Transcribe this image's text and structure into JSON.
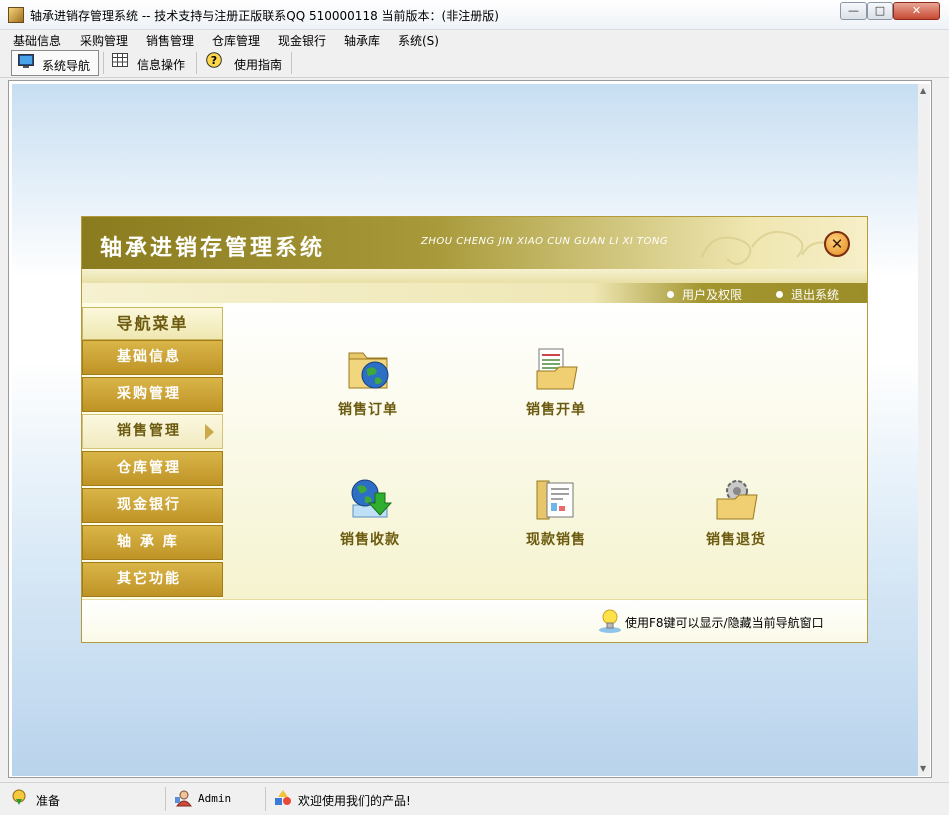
{
  "window": {
    "title": "轴承进销存管理系统 -- 技术支持与注册正版联系QQ 510000118   当前版本：(非注册版)",
    "min_label": "—",
    "max_label": "□",
    "close_label": "✕"
  },
  "menu": [
    {
      "label": "基础信息"
    },
    {
      "label": "采购管理"
    },
    {
      "label": "销售管理"
    },
    {
      "label": "仓库管理"
    },
    {
      "label": "现金银行"
    },
    {
      "label": "轴承库"
    },
    {
      "label": "系统(S)"
    }
  ],
  "toolbar": [
    {
      "label": "系统导航",
      "icon": "monitor-icon",
      "active": true
    },
    {
      "label": "信息操作",
      "icon": "grid-icon",
      "active": false
    },
    {
      "label": "使用指南",
      "icon": "help-icon",
      "active": false
    }
  ],
  "panel": {
    "title": "轴承进销存管理系统",
    "subtitle": "ZHOU CHENG JIN XIAO CUN GUAN LI XI TONG",
    "close_icon": "close-circle-icon",
    "close_glyph": "✕",
    "links": [
      {
        "label": "用户及权限"
      },
      {
        "label": "退出系统"
      }
    ],
    "nav_header": "导航菜单",
    "nav_items": [
      {
        "label": "基础信息",
        "selected": false
      },
      {
        "label": "采购管理",
        "selected": false
      },
      {
        "label": "销售管理",
        "selected": true
      },
      {
        "label": "仓库管理",
        "selected": false
      },
      {
        "label": "现金银行",
        "selected": false
      },
      {
        "label": "轴 承 库",
        "selected": false
      },
      {
        "label": "其它功能",
        "selected": false
      }
    ],
    "functions": [
      {
        "label": "销售订单",
        "icon": "folder-globe-icon"
      },
      {
        "label": "销售开单",
        "icon": "folder-document-icon"
      },
      {
        "label": "销售收款",
        "icon": "globe-download-icon"
      },
      {
        "label": "现款销售",
        "icon": "folder-form-icon"
      },
      {
        "label": "销售退货",
        "icon": "folder-gear-icon"
      }
    ],
    "tip": "使用F8键可以显示/隐藏当前导航窗口",
    "tip_icon": "lightbulb-icon"
  },
  "statusbar": [
    {
      "label": "准备",
      "icon": "ready-icon"
    },
    {
      "label": "Admin",
      "icon": "user-icon"
    },
    {
      "label": "欢迎使用我们的产品!",
      "icon": "shapes-icon"
    }
  ],
  "colors": {
    "panel_header": "#8a7c1e",
    "nav_item": "#cca336",
    "nav_text_selected": "#6b5a0e",
    "function_text": "#6b5a0e"
  }
}
